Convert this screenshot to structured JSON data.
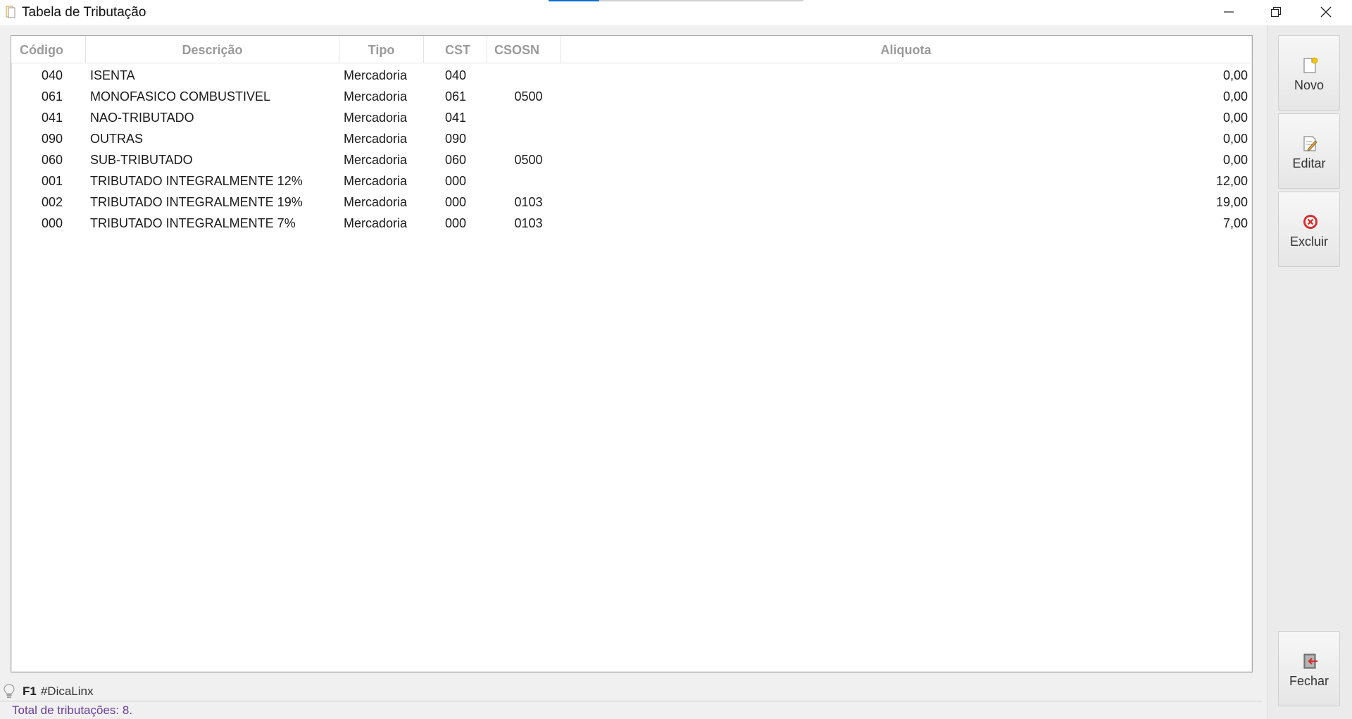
{
  "window": {
    "title": "Tabela de Tributação"
  },
  "grid": {
    "columns": {
      "codigo": "Código",
      "descricao": "Descrição",
      "tipo": "Tipo",
      "cst": "CST",
      "csosn": "CSOSN",
      "aliquota": "Aliquota"
    },
    "rows": [
      {
        "codigo": "040",
        "descricao": "ISENTA",
        "tipo": "Mercadoria",
        "cst": "040",
        "csosn": "",
        "aliquota": "0,00"
      },
      {
        "codigo": "061",
        "descricao": "MONOFASICO COMBUSTIVEL",
        "tipo": "Mercadoria",
        "cst": "061",
        "csosn": "0500",
        "aliquota": "0,00"
      },
      {
        "codigo": "041",
        "descricao": "NAO-TRIBUTADO",
        "tipo": "Mercadoria",
        "cst": "041",
        "csosn": "",
        "aliquota": "0,00"
      },
      {
        "codigo": "090",
        "descricao": "OUTRAS",
        "tipo": "Mercadoria",
        "cst": "090",
        "csosn": "",
        "aliquota": "0,00"
      },
      {
        "codigo": "060",
        "descricao": "SUB-TRIBUTADO",
        "tipo": "Mercadoria",
        "cst": "060",
        "csosn": "0500",
        "aliquota": "0,00"
      },
      {
        "codigo": "001",
        "descricao": "TRIBUTADO INTEGRALMENTE 12%",
        "tipo": "Mercadoria",
        "cst": "000",
        "csosn": "",
        "aliquota": "12,00"
      },
      {
        "codigo": "002",
        "descricao": "TRIBUTADO INTEGRALMENTE 19%",
        "tipo": "Mercadoria",
        "cst": "000",
        "csosn": "0103",
        "aliquota": "19,00"
      },
      {
        "codigo": "000",
        "descricao": "TRIBUTADO INTEGRALMENTE 7%",
        "tipo": "Mercadoria",
        "cst": "000",
        "csosn": "0103",
        "aliquota": "7,00"
      }
    ]
  },
  "actions": {
    "novo": "Novo",
    "editar": "Editar",
    "excluir": "Excluir",
    "fechar": "Fechar"
  },
  "tip": {
    "key": "F1",
    "text": "#DicaLinx"
  },
  "status": {
    "text": "Total de tributações: 8."
  },
  "colors": {
    "status_text": "#6a3d9a",
    "header_text": "#9a9a9a",
    "excluir_icon": "#d32f2f",
    "fechar_icon": "#d32f2f",
    "novo_icon_star": "#f5c518"
  }
}
